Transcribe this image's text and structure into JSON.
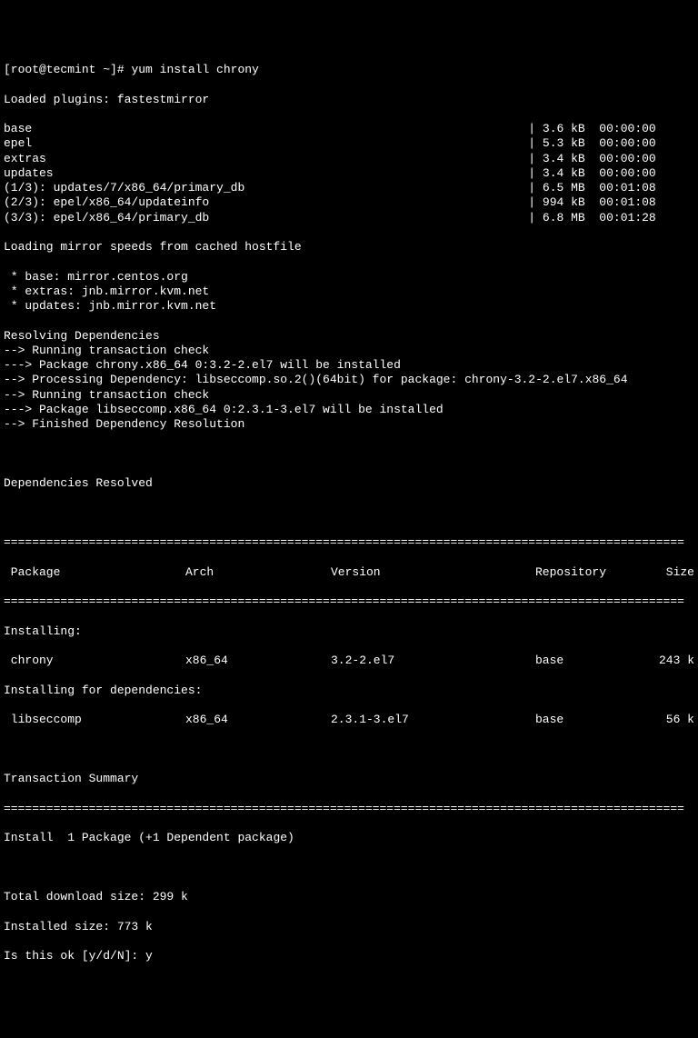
{
  "prompt": "[root@tecmint ~]# ",
  "command": "yum install chrony",
  "plugins_line": "Loaded plugins: fastestmirror",
  "repos": [
    {
      "name": "base",
      "size": "3.6 kB",
      "time": "00:00:00"
    },
    {
      "name": "epel",
      "size": "5.3 kB",
      "time": "00:00:00"
    },
    {
      "name": "extras",
      "size": "3.4 kB",
      "time": "00:00:00"
    },
    {
      "name": "updates",
      "size": "3.4 kB",
      "time": "00:00:00"
    },
    {
      "name": "(1/3): updates/7/x86_64/primary_db",
      "size": "6.5 MB",
      "time": "00:01:08"
    },
    {
      "name": "(2/3): epel/x86_64/updateinfo",
      "size": "994 kB",
      "time": "00:01:08"
    },
    {
      "name": "(3/3): epel/x86_64/primary_db",
      "size": "6.8 MB",
      "time": "00:01:28"
    }
  ],
  "mirror_header": "Loading mirror speeds from cached hostfile",
  "mirrors": [
    " * base: mirror.centos.org",
    " * extras: jnb.mirror.kvm.net",
    " * updates: jnb.mirror.kvm.net"
  ],
  "dep_lines": [
    "Resolving Dependencies",
    "--> Running transaction check",
    "---> Package chrony.x86_64 0:3.2-2.el7 will be installed",
    "--> Processing Dependency: libseccomp.so.2()(64bit) for package: chrony-3.2-2.el7.x86_64",
    "--> Running transaction check",
    "---> Package libseccomp.x86_64 0:2.3.1-3.el7 will be installed",
    "--> Finished Dependency Resolution"
  ],
  "deps_resolved": "Dependencies Resolved",
  "table_divider": "================================================================================================",
  "table_header": {
    "package": " Package",
    "arch": "Arch",
    "version": "Version",
    "repository": "Repository",
    "size": "Size"
  },
  "installing_label": "Installing:",
  "installing_deps_label": "Installing for dependencies:",
  "packages": [
    {
      "name": " chrony",
      "arch": "x86_64",
      "version": "3.2-2.el7",
      "repo": "base",
      "size": "243 k"
    },
    {
      "name": " libseccomp",
      "arch": "x86_64",
      "version": "2.3.1-3.el7",
      "repo": "base",
      "size": "56 k"
    }
  ],
  "txn_summary": "Transaction Summary",
  "install_line": "Install  1 Package (+1 Dependent package)",
  "download_size": "Total download size: 299 k",
  "installed_size": "Installed size: 773 k",
  "confirm_prompt": "Is this ok [y/d/N]: ",
  "confirm_answer": "y"
}
